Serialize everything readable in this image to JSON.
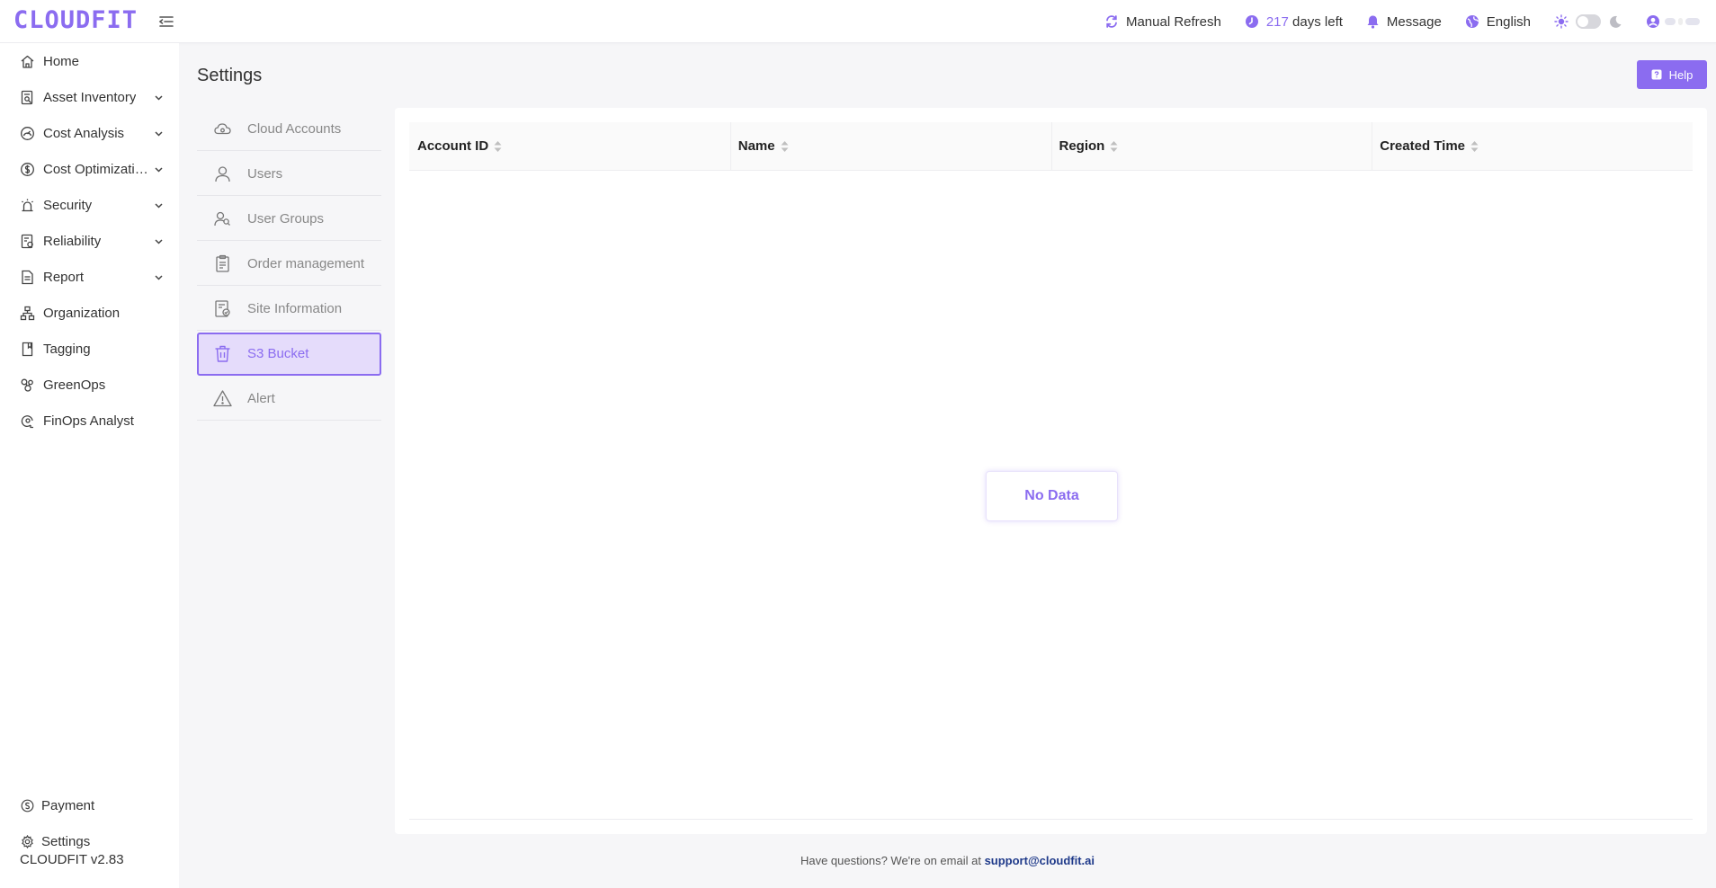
{
  "app": {
    "logo": "CLOUDFIT"
  },
  "topbar": {
    "manual_refresh": "Manual Refresh",
    "days_count": "217",
    "days_suffix": "days left",
    "message": "Message",
    "language": "English"
  },
  "sidebar": {
    "items": [
      {
        "label": "Home",
        "icon": "home-icon"
      },
      {
        "label": "Asset Inventory",
        "icon": "inventory-icon",
        "expandable": true
      },
      {
        "label": "Cost Analysis",
        "icon": "gauge-icon",
        "expandable": true
      },
      {
        "label": "Cost Optimization",
        "icon": "dollar-icon",
        "expandable": true
      },
      {
        "label": "Security",
        "icon": "alarm-icon",
        "expandable": true
      },
      {
        "label": "Reliability",
        "icon": "reliability-icon",
        "expandable": true
      },
      {
        "label": "Report",
        "icon": "report-icon",
        "expandable": true
      },
      {
        "label": "Organization",
        "icon": "org-icon"
      },
      {
        "label": "Tagging",
        "icon": "tag-icon"
      },
      {
        "label": "GreenOps",
        "icon": "leaf-icon"
      },
      {
        "label": "FinOps Analyst",
        "icon": "analyst-icon"
      }
    ],
    "bottom_items": [
      {
        "label": "Payment",
        "icon": "payment-icon"
      },
      {
        "label": "Settings",
        "icon": "gear-icon"
      }
    ],
    "version": "CLOUDFIT v2.83"
  },
  "main": {
    "title": "Settings",
    "help_label": "Help",
    "settings_menu": [
      {
        "label": "Cloud Accounts",
        "icon": "cloud-icon"
      },
      {
        "label": "Users",
        "icon": "user-icon"
      },
      {
        "label": "User Groups",
        "icon": "user-group-icon"
      },
      {
        "label": "Order management",
        "icon": "clipboard-icon"
      },
      {
        "label": "Site Information",
        "icon": "site-info-icon"
      },
      {
        "label": "S3 Bucket",
        "icon": "bucket-icon",
        "active": true
      },
      {
        "label": "Alert",
        "icon": "warning-icon"
      }
    ],
    "table": {
      "columns": [
        "Account ID",
        "Name",
        "Region",
        "Created Time"
      ],
      "rows": [],
      "empty_text": "No Data"
    }
  },
  "footer": {
    "text": "Have questions? We're on email at",
    "email": "support@cloudfit.ai"
  },
  "colors": {
    "accent": "#8b6cf0",
    "active_bg": "#e5dcfb",
    "link": "#1f3a8a"
  }
}
